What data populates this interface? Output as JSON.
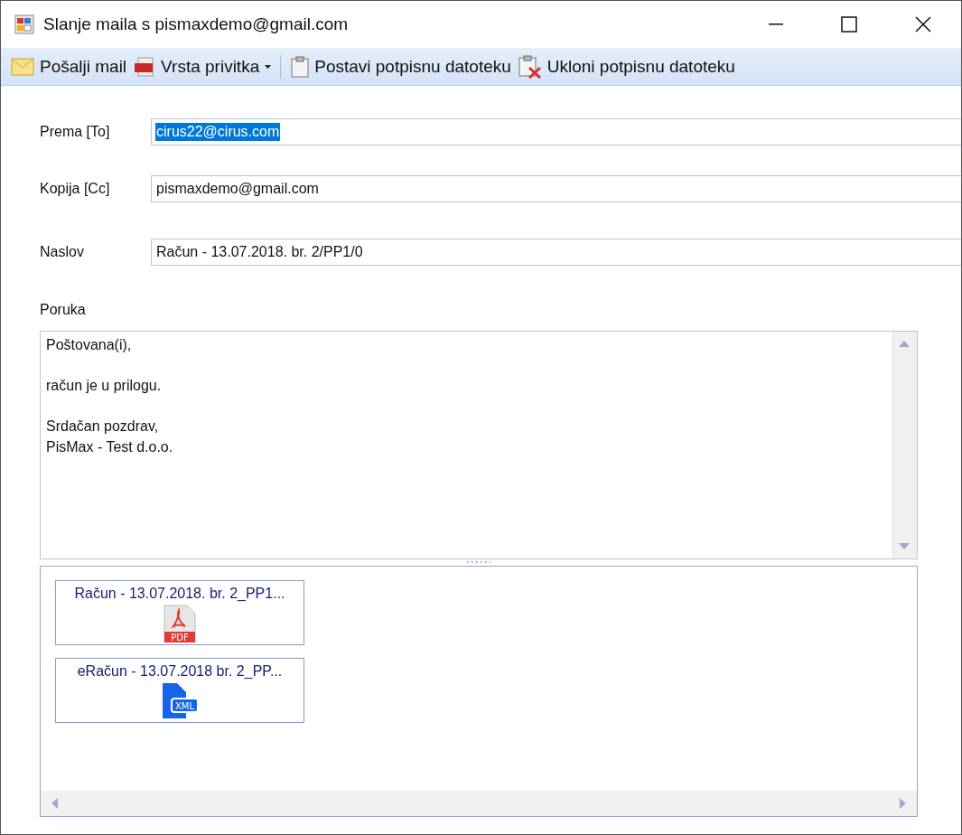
{
  "window": {
    "title": "Slanje maila s pismaxdemo@gmail.com"
  },
  "toolbar": [
    {
      "label": "Pošalji mail",
      "dropdown": false,
      "separator_after": false
    },
    {
      "label": "Vrsta privitka",
      "dropdown": true,
      "separator_after": true
    },
    {
      "label": "Postavi potpisnu datoteku",
      "dropdown": false,
      "separator_after": false
    },
    {
      "label": "Ukloni potpisnu datoteku",
      "dropdown": false,
      "separator_after": false
    }
  ],
  "fields": [
    {
      "label": "Prema [To]",
      "value": "cirus22@cirus.com",
      "selected": true
    },
    {
      "label": "Kopija [Cc]",
      "value": "pismaxdemo@gmail.com",
      "selected": false
    },
    {
      "label": "Naslov",
      "value": "Račun - 13.07.2018. br. 2/PP1/0",
      "selected": false
    }
  ],
  "message": {
    "label": "Poruka",
    "paragraphs": [
      [
        "Poštovana(i),"
      ],
      [
        "račun je u prilogu."
      ],
      [
        "Srdačan pozdrav,",
        "PisMax - Test d.o.o."
      ]
    ]
  },
  "attachments": [
    {
      "name": "Račun - 13.07.2018. br. 2_PP1...",
      "kind": "pdf",
      "file_label": "PDF"
    },
    {
      "name": "eRačun -  13.07.2018 br. 2_PP...",
      "kind": "xml",
      "file_label": "XML"
    }
  ]
}
